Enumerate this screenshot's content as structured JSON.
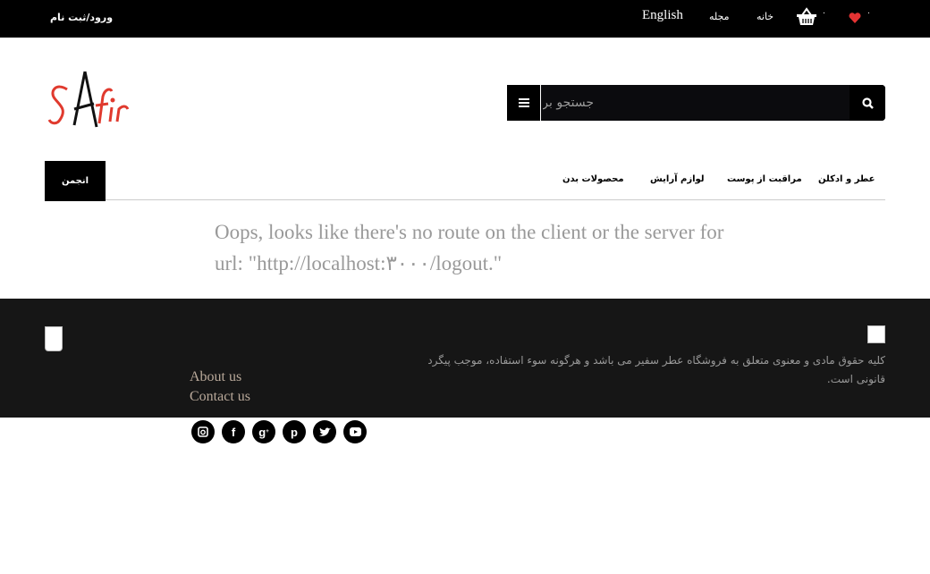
{
  "topbar": {
    "login_label": "ورود/ثبت نام",
    "language_label": "English",
    "magazine_label": "مجله",
    "home_label": "خانه",
    "cart_count": "۰",
    "wishlist_count": "۰",
    "heart_color": "#e53333"
  },
  "logo": {
    "text": "SAFir"
  },
  "search": {
    "placeholder": "جستجو برای"
  },
  "categories": [
    {
      "label": "عطر و ادکلن"
    },
    {
      "label": "مراقبت از پوست"
    },
    {
      "label": "لوازم آرایش"
    },
    {
      "label": "محصولات بدن"
    }
  ],
  "forum_label": "انجمن",
  "error_message": "Oops, looks like there's no route on the client or the server for url: \"http://localhost:۳۰۰۰/logout.\"",
  "footer": {
    "links": [
      "About us",
      "Contact us"
    ],
    "copyright": "کلیه حقوق مادی و معنوی متعلق به فروشگاه عطر سفیر می باشد و هرگونه سوء استفاده، موجب پیگرد قانونی است."
  },
  "social": [
    "instagram",
    "facebook",
    "google-plus",
    "pinterest",
    "twitter",
    "youtube"
  ]
}
